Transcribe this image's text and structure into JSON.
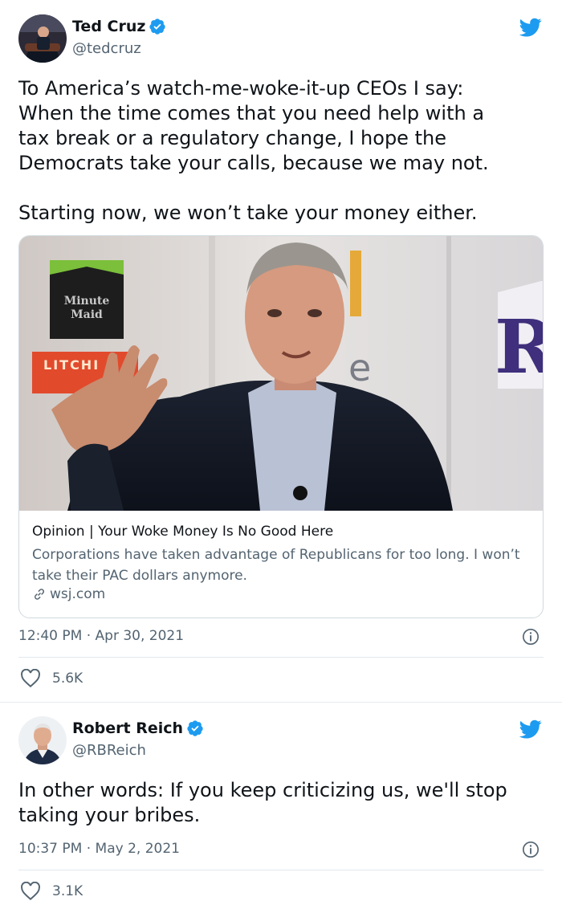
{
  "tweets": [
    {
      "author": {
        "display_name": "Ted Cruz",
        "handle": "@tedcruz",
        "verified": true
      },
      "text": "To America’s watch-me-woke-it-up CEOs I say:\nWhen the time comes that you need help with a\ntax break or a regulatory change, I hope the\nDemocrats take your calls, because we may not.\n\nStarting now, we won’t take your money either.",
      "link_card": {
        "image_signs": {
          "brand_logo": "Minute\nMaid",
          "product_sign": "LITCHI",
          "right_letter": "R"
        },
        "title": "Opinion | Your Woke Money Is No Good Here",
        "description": "Corporations have taken advantage of Republicans for too long. I won’t take their PAC dollars anymore.",
        "domain": "wsj.com"
      },
      "timestamp": "12:40 PM · Apr 30, 2021",
      "likes": "5.6K"
    },
    {
      "author": {
        "display_name": "Robert Reich",
        "handle": "@RBReich",
        "verified": true
      },
      "text": "In other words: If you keep criticizing us, we'll stop\ntaking your bribes.",
      "timestamp": "10:37 PM · May 2, 2021",
      "likes": "3.1K"
    }
  ],
  "icons": {
    "verified": "verified-badge-icon",
    "twitter": "twitter-bird-icon",
    "info": "info-icon",
    "heart": "heart-icon",
    "link": "link-icon"
  },
  "colors": {
    "twitter_blue": "#1d9bf0",
    "text_primary": "#0f1419",
    "text_secondary": "#536471",
    "border": "#cfd9de"
  }
}
